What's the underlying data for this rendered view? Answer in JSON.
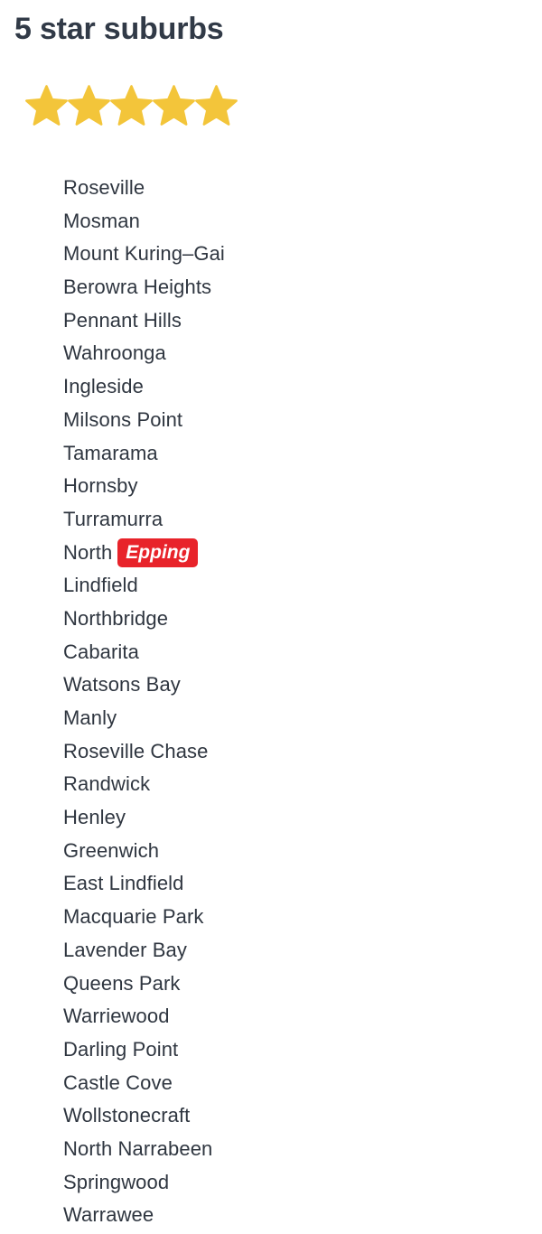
{
  "page": {
    "title": "5 star suburbs",
    "background_color": "#ffffff",
    "text_color": "#2f3640",
    "heading_color": "#313a47"
  },
  "rating": {
    "icon_name": "star-icon",
    "filled_count": 5,
    "max": 5,
    "color": "#f3c53a",
    "value_label": "5"
  },
  "highlight": {
    "background_color": "#e8232a",
    "text_color": "#ffffff",
    "term": "Epping"
  },
  "list": {
    "items": [
      {
        "text": "Roseville"
      },
      {
        "text": "Mosman"
      },
      {
        "text": "Mount Kuring–Gai"
      },
      {
        "text": "Berowra Heights"
      },
      {
        "text": "Pennant Hills"
      },
      {
        "text": "Wahroonga"
      },
      {
        "text": "Ingleside"
      },
      {
        "text": "Milsons Point"
      },
      {
        "text": "Tamarama"
      },
      {
        "text": "Hornsby"
      },
      {
        "text": "Turramurra"
      },
      {
        "text": "North Epping",
        "prefix": "North",
        "highlight": "Epping"
      },
      {
        "text": "Lindfield"
      },
      {
        "text": "Northbridge"
      },
      {
        "text": "Cabarita"
      },
      {
        "text": "Watsons Bay"
      },
      {
        "text": "Manly"
      },
      {
        "text": "Roseville Chase"
      },
      {
        "text": "Randwick"
      },
      {
        "text": "Henley"
      },
      {
        "text": "Greenwich"
      },
      {
        "text": "East Lindfield"
      },
      {
        "text": "Macquarie Park"
      },
      {
        "text": "Lavender Bay"
      },
      {
        "text": "Queens Park"
      },
      {
        "text": "Warriewood"
      },
      {
        "text": "Darling Point"
      },
      {
        "text": "Castle Cove"
      },
      {
        "text": "Wollstonecraft"
      },
      {
        "text": "North Narrabeen"
      },
      {
        "text": "Springwood"
      },
      {
        "text": "Warrawee"
      }
    ]
  }
}
